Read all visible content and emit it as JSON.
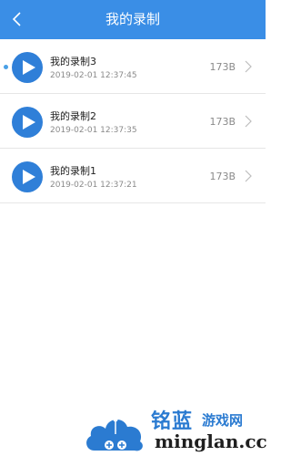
{
  "header": {
    "title": "我的录制",
    "back_icon": "chevron-left-icon"
  },
  "recordings": [
    {
      "name": "我的录制3",
      "time": "2019-02-01 12:37:45",
      "size": "173B",
      "selected": true
    },
    {
      "name": "我的录制2",
      "time": "2019-02-01 12:37:35",
      "size": "173B",
      "selected": false
    },
    {
      "name": "我的录制1",
      "time": "2019-02-01 12:37:21",
      "size": "173B",
      "selected": false
    }
  ],
  "watermark": {
    "cn_main": "铭蓝",
    "cn_sub": "游戏网",
    "en": "minglan.cc"
  },
  "colors": {
    "header": "#3a8ee6",
    "play": "#2f7fd8",
    "watermark": "#2b7bd1"
  }
}
